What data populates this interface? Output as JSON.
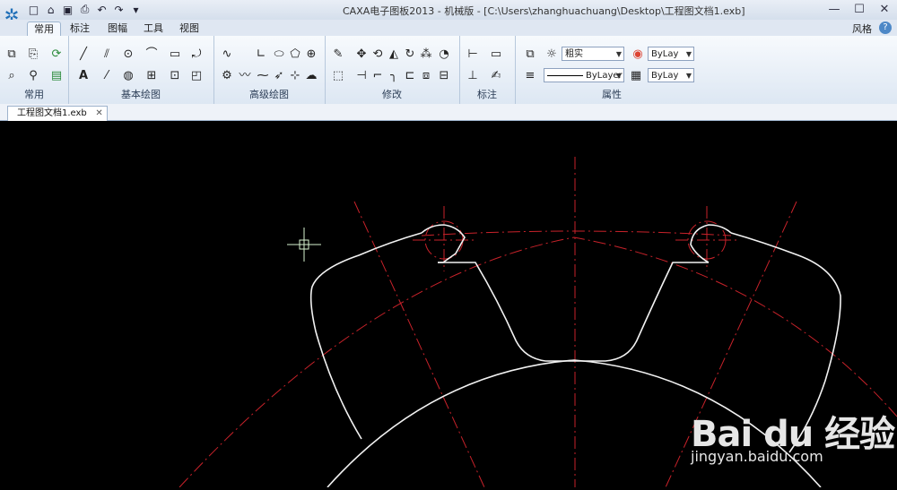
{
  "titlebar": {
    "title": "CAXA电子图板2013 - 机械版 - [C:\\Users\\zhanghuachuang\\Desktop\\工程图文档1.exb]",
    "minimize": "—",
    "maximize": "☐",
    "close": "✕"
  },
  "tabs": [
    "常用",
    "标注",
    "图幅",
    "工具",
    "视图"
  ],
  "style_menu": "风格",
  "ribbon": {
    "groups": [
      "常用",
      "基本绘图",
      "高级绘图",
      "修改",
      "标注",
      "属性"
    ],
    "linetype_combo": "粗实",
    "color_combo": "ByLay",
    "line_combo": "ByLayer",
    "weight_combo": "ByLay"
  },
  "document_tab": "工程图文档1.exb",
  "watermark": {
    "logo": "Bai du 经验",
    "url": "jingyan.baidu.com"
  }
}
